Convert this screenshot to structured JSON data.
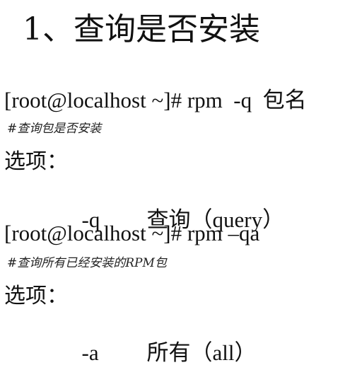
{
  "title": "1、查询是否安装",
  "blocks": [
    {
      "command": "[root@localhost ~]# rpm  -q  包名",
      "comment": "#查询包是否安装",
      "options_label": "选项：",
      "option": {
        "flag": "-q",
        "desc": "查询（query）"
      }
    },
    {
      "command": "[root@localhost ~]# rpm –qa",
      "comment": "#查询所有已经安装的RPM包",
      "options_label": "选项：",
      "option": {
        "flag": "-a",
        "desc": "所有（all）"
      }
    }
  ]
}
